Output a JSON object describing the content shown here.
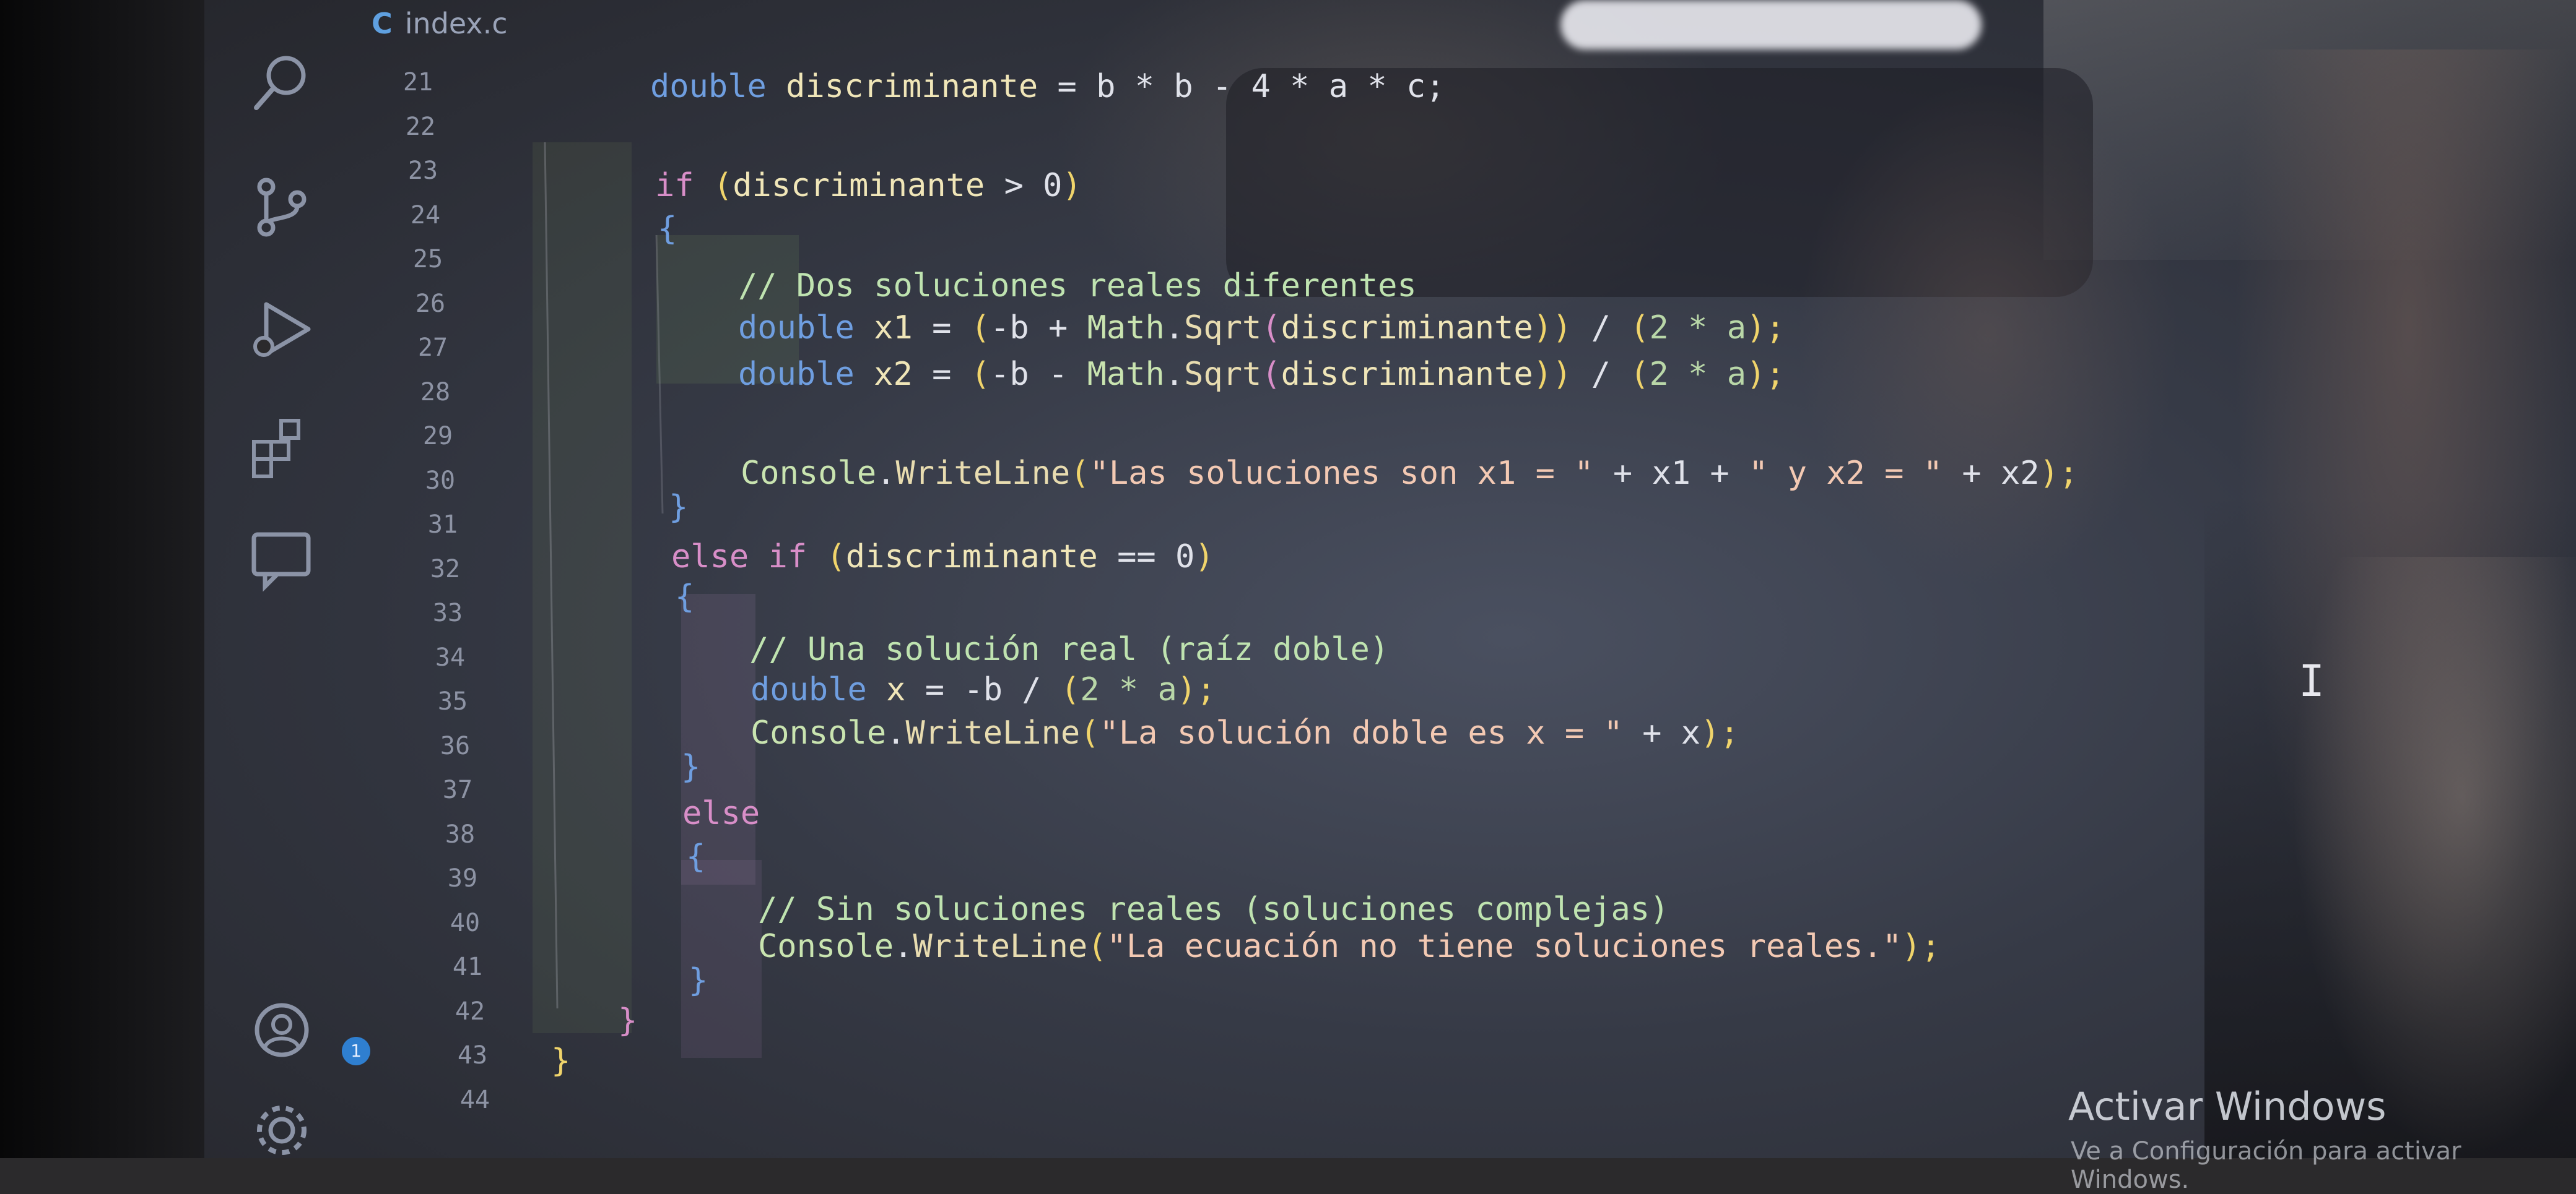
{
  "tab": {
    "icon_label": "C",
    "filename": "index.c"
  },
  "activity_bar": {
    "icons": [
      "search-icon",
      "source-control-icon",
      "run-debug-icon",
      "extensions-icon",
      "remote-explorer-icon",
      "account-icon",
      "settings-gear-icon"
    ],
    "account_badge": "1"
  },
  "line_numbers": [
    "21",
    "22",
    "23",
    "24",
    "25",
    "26",
    "27",
    "28",
    "29",
    "30",
    "31",
    "32",
    "33",
    "34",
    "35",
    "36",
    "37",
    "38",
    "39",
    "40",
    "41",
    "42",
    "43",
    "44"
  ],
  "code": {
    "l21": [
      "double",
      "discriminante",
      "=",
      "b * b - 4 * a * c;"
    ],
    "l23": [
      "if",
      "(",
      "discriminante",
      "> 0",
      ")"
    ],
    "l24": [
      "{"
    ],
    "l25": [
      "// Dos soluciones reales diferentes"
    ],
    "l26": [
      "double",
      "x1",
      "= ",
      "(",
      "-b + ",
      "Math",
      ".",
      "Sqrt",
      "(",
      "discriminante",
      "))",
      " / ",
      "(",
      "2 * a",
      ");"
    ],
    "l27": [
      "double",
      "x2",
      "= ",
      "(",
      "-b - ",
      "Math",
      ".",
      "Sqrt",
      "(",
      "discriminante",
      "))",
      " / ",
      "(",
      "2 * a",
      ");"
    ],
    "l29": [
      "Console",
      ".",
      "WriteLine",
      "(",
      "\"Las soluciones son x1 = \"",
      " + x1 + ",
      "\" y x2 = \"",
      " + x2",
      ");"
    ],
    "l30": [
      "}"
    ],
    "l31": [
      "else if",
      " (",
      "discriminante",
      " == 0",
      ")"
    ],
    "l32": [
      "{"
    ],
    "l33": [
      "// Una solución real (raíz doble)"
    ],
    "l34": [
      "double",
      "x",
      " = -b / ",
      "(",
      "2 * a",
      ");"
    ],
    "l35": [
      "Console",
      ".",
      "WriteLine",
      "(",
      "\"La solución doble es x = \"",
      " + x",
      ");"
    ],
    "l36": [
      "}"
    ],
    "l37": [
      "else"
    ],
    "l38": [
      "{"
    ],
    "l39": [
      "// Sin soluciones reales (soluciones complejas)"
    ],
    "l40": [
      "Console",
      ".",
      "WriteLine",
      "(",
      "\"La ecuación no tiene soluciones reales.\"",
      ");"
    ],
    "l41": [
      "}"
    ],
    "l42": [
      "}"
    ],
    "l43": [
      "}"
    ]
  },
  "watermark": {
    "title": "Activar Windows",
    "subtitle": "Ve a Configuración para activar Windows."
  },
  "colors": {
    "keyword": "#6f9ee0",
    "control_keyword": "#d88ec8",
    "string": "#f3c9b3",
    "comment": "#bfe3b0",
    "bracket": "#f0d46b",
    "badge": "#2f7fd0"
  }
}
